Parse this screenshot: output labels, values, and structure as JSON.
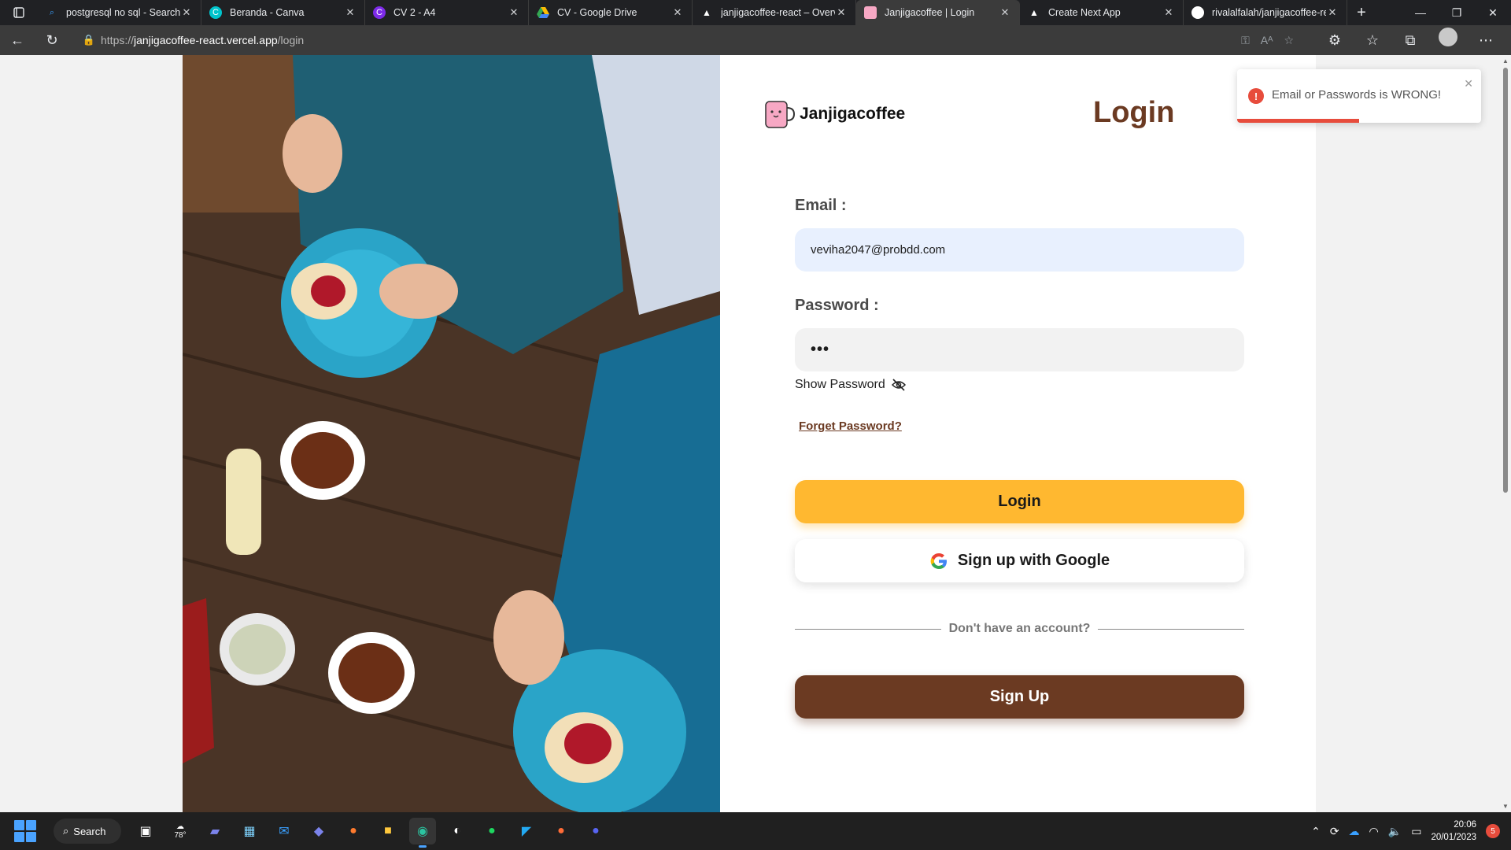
{
  "browser": {
    "tabs": [
      {
        "title": "postgresql no sql - Search",
        "favicon": "bing-search-icon",
        "active": false
      },
      {
        "title": "Beranda - Canva",
        "favicon": "canva-icon",
        "active": false
      },
      {
        "title": "CV 2 - A4",
        "favicon": "canva-icon",
        "active": false
      },
      {
        "title": "CV - Google Drive",
        "favicon": "google-drive-icon",
        "active": false
      },
      {
        "title": "janjigacoffee-react – Overv",
        "favicon": "vercel-icon",
        "active": false
      },
      {
        "title": "Janjigacoffee | Login",
        "favicon": "coffee-mug-icon",
        "active": true
      },
      {
        "title": "Create Next App",
        "favicon": "vercel-icon",
        "active": false
      },
      {
        "title": "rivalalfalah/janjigacoffee-re",
        "favicon": "github-icon",
        "active": false
      }
    ],
    "url": {
      "scheme": "https://",
      "host": "janjigacoffee-react.vercel.app",
      "path": "/login"
    }
  },
  "page": {
    "brand_name": "Janjigacoffee",
    "title": "Login",
    "email_label": "Email :",
    "email_value": "veviha2047@probdd.com",
    "password_label": "Password :",
    "password_value": "•••",
    "show_password_label": "Show Password",
    "forget_password_label": "Forget Password?",
    "login_button": "Login",
    "google_button": "Sign up with Google",
    "divider_text": "Don't have an account?",
    "signup_button": "Sign Up"
  },
  "toast": {
    "message": "Email or Passwords is WRONG!",
    "type": "error",
    "progress_fraction": 0.5
  },
  "taskbar": {
    "search_label": "Search",
    "weather": "78°",
    "time": "20:06",
    "date": "20/01/2023",
    "notification_count": "5"
  },
  "colors": {
    "brand_brown": "#6b3a22",
    "login_yellow": "#ffb830",
    "error_red": "#e74c3c",
    "email_field_bg": "#e8f0fe"
  }
}
